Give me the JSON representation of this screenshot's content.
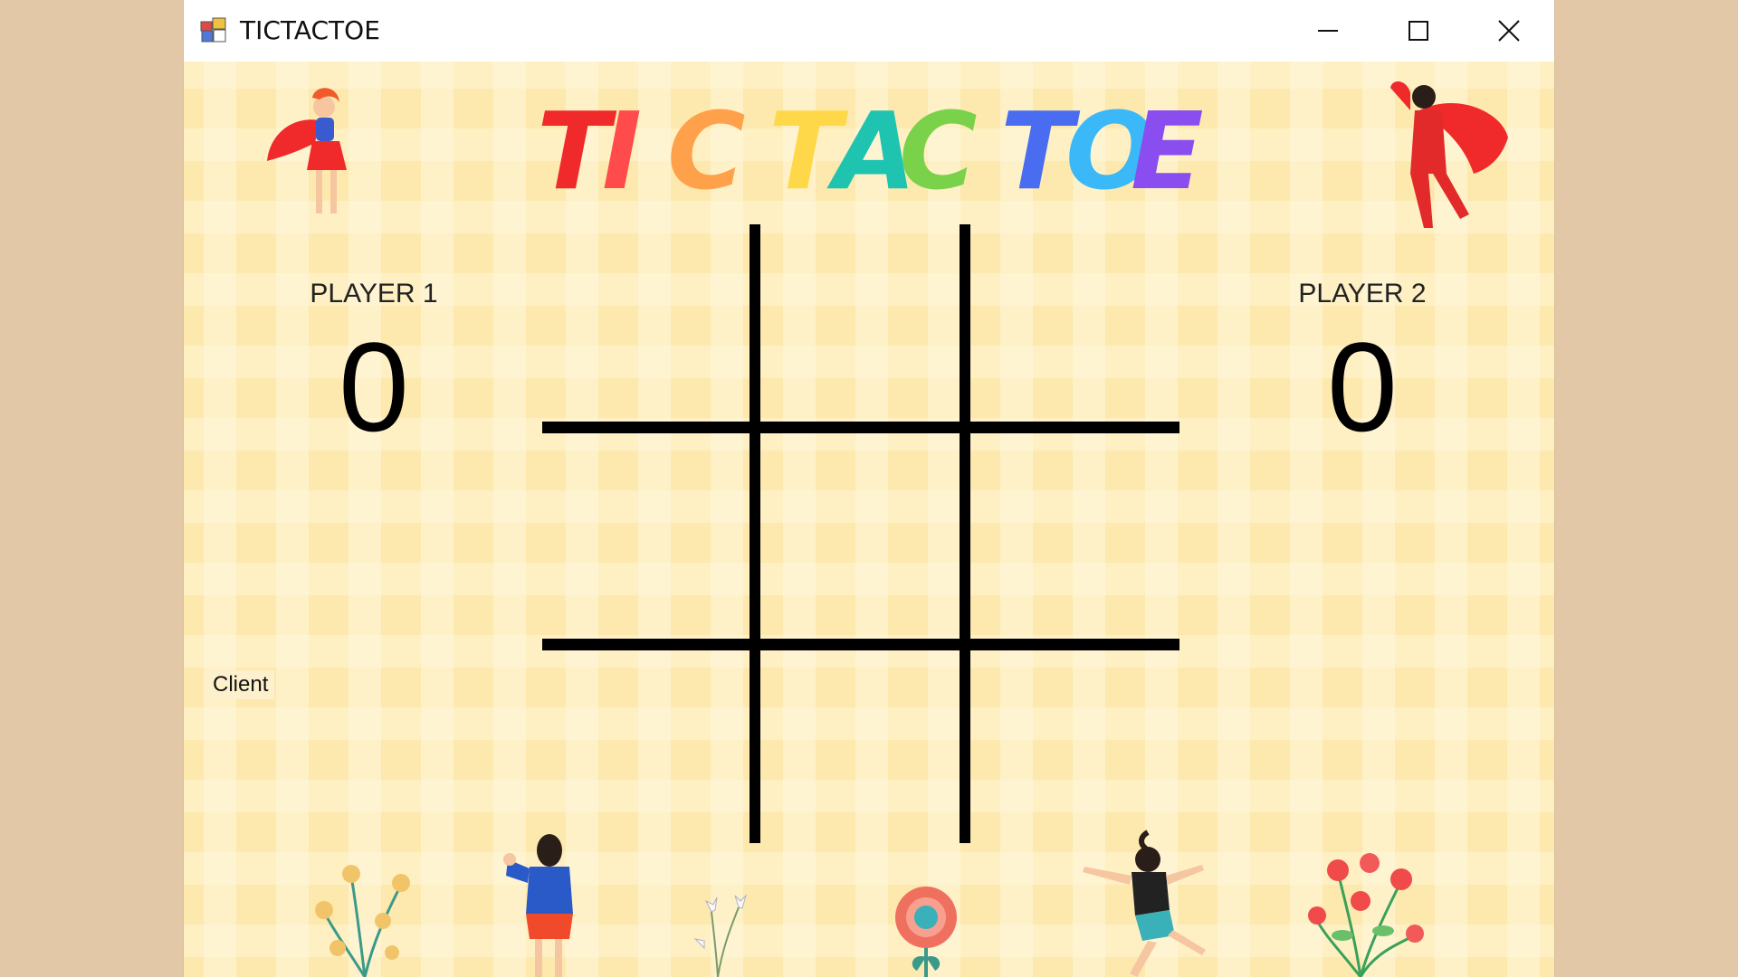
{
  "window": {
    "title": "TICTACTOE",
    "controls": {
      "minimize": "minimize-icon",
      "maximize": "maximize-icon",
      "close": "close-icon"
    }
  },
  "logo": {
    "words": [
      {
        "letters": [
          {
            "ch": "T",
            "color": "#f02a2a"
          },
          {
            "ch": "I",
            "color": "#ff4b4b"
          },
          {
            "ch": "C",
            "color": "#ffa04a"
          }
        ]
      },
      {
        "letters": [
          {
            "ch": "T",
            "color": "#ffd84a"
          },
          {
            "ch": "A",
            "color": "#1fc4b0"
          },
          {
            "ch": "C",
            "color": "#7ad24a"
          }
        ]
      },
      {
        "letters": [
          {
            "ch": "T",
            "color": "#4a6cf0"
          },
          {
            "ch": "O",
            "color": "#3ab8f8"
          },
          {
            "ch": "E",
            "color": "#8a4ef0"
          }
        ]
      }
    ]
  },
  "players": [
    {
      "label": "PLAYER 1",
      "score": "0"
    },
    {
      "label": "PLAYER 2",
      "score": "0"
    }
  ],
  "board": {
    "cells": [
      "",
      "",
      "",
      "",
      "",
      "",
      "",
      "",
      ""
    ]
  },
  "client_label": "Client",
  "decorations": [
    "hero-girl-left-illustration",
    "hero-girl-right-illustration",
    "yellow-flower-bush-illustration",
    "girl-back-illustration",
    "white-flower-illustration",
    "pink-flower-illustration",
    "dancing-girl-illustration",
    "red-flower-bush-illustration"
  ]
}
